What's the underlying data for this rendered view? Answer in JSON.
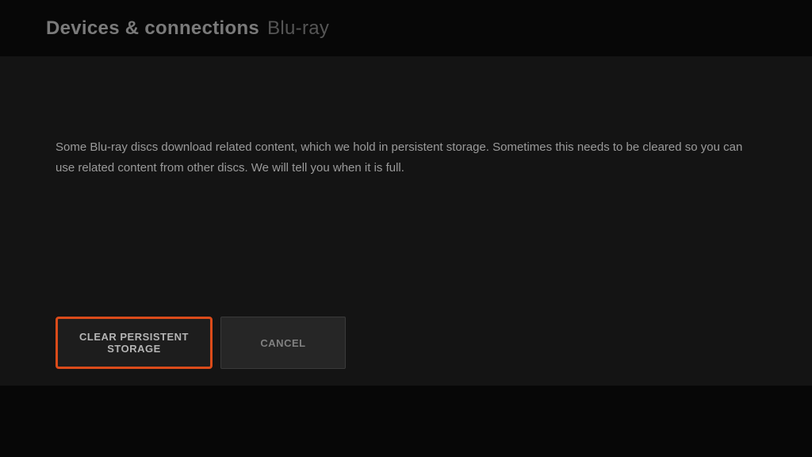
{
  "header": {
    "title": "Devices & connections",
    "subtitle": "Blu-ray"
  },
  "main": {
    "description": "Some Blu-ray discs download related content, which we hold in persistent storage.  Sometimes this needs to be cleared so you can use related content from other discs. We will tell you when it is full."
  },
  "buttons": {
    "clear_label": "CLEAR PERSISTENT STORAGE",
    "cancel_label": "CANCEL"
  }
}
